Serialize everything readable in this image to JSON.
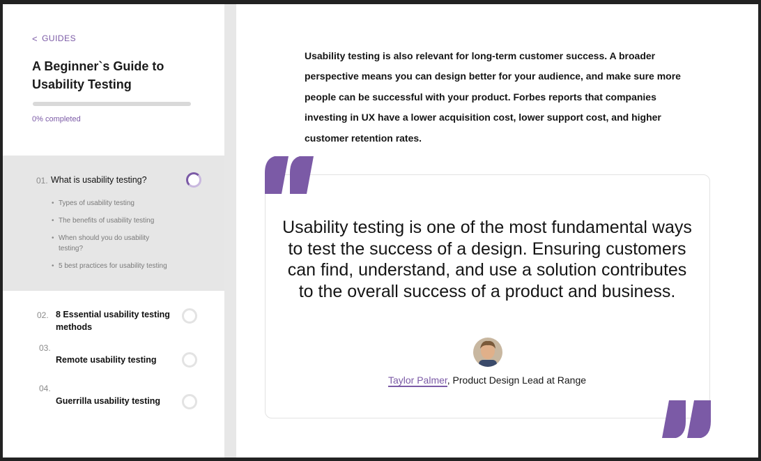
{
  "sidebar": {
    "back_label": "GUIDES",
    "guide_title": "A Beginner`s  Guide to Usability Testing",
    "progress_fraction": 0,
    "progress_label": "0% completed",
    "sections": [
      {
        "number": "01.",
        "title": "What is usability testing?",
        "status": "in-progress",
        "subsections": [
          "Types of usability testing",
          "The benefits of usability testing",
          "When should you do usability testing?",
          "5 best practices for usability testing"
        ]
      },
      {
        "number": "02.",
        "title": "8 Essential usability testing methods",
        "status": "not-started"
      },
      {
        "number": "03.",
        "title": "Remote usability testing",
        "status": "not-started"
      },
      {
        "number": "04.",
        "title": "Guerrilla usability testing",
        "status": "not-started"
      }
    ]
  },
  "main": {
    "intro_paragraph": "Usability testing is also relevant for long-term customer success. A broader perspective means you can design better for your audience, and make sure more people can be successful with your product. Forbes reports that companies investing in UX have a lower acquisition cost, lower support cost, and higher customer retention rates.",
    "quote": {
      "text": "Usability testing is one of the most fundamental ways to test the success of a design. Ensuring customers can find, understand, and use a solution contributes to the overall success of a product and business.",
      "author_name": "Taylor Palmer",
      "author_role": ", Product Design Lead at Range"
    }
  },
  "colors": {
    "accent": "#7b5aa6",
    "active_bg": "#e6e6e6",
    "divider": "#e7e7e7"
  },
  "icons": {
    "back": "chevron-left-icon",
    "quote_open": "quote-open-icon",
    "quote_close": "quote-close-icon",
    "status": "progress-ring-icon"
  }
}
